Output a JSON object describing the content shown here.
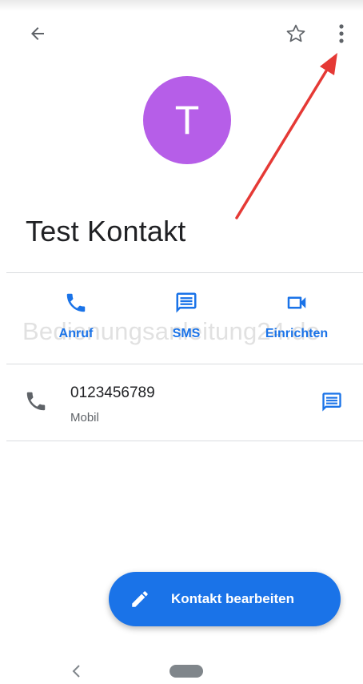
{
  "toolbar": {
    "back_icon": "arrow-back-icon",
    "favorite_icon": "star-outline-icon",
    "more_icon": "more-vert-icon"
  },
  "contact": {
    "initial": "T",
    "avatar_color": "#b65ee8",
    "name": "Test Kontakt"
  },
  "actions": [
    {
      "label": "Anruf",
      "icon": "phone-icon"
    },
    {
      "label": "SMS",
      "icon": "message-icon"
    },
    {
      "label": "Einrichten",
      "icon": "videocam-icon"
    }
  ],
  "watermark": "Bedienungsanleitung24.de",
  "phone": {
    "number": "0123456789",
    "type": "Mobil",
    "icon": "phone-icon",
    "message_icon": "message-icon"
  },
  "fab": {
    "label": "Kontakt bearbeiten",
    "icon": "pencil-icon"
  },
  "nav": {
    "back_icon": "nav-back-chevron-icon",
    "home_icon": "home-pill-icon"
  },
  "colors": {
    "accent": "#1a73e8",
    "annotation_arrow": "#e53935"
  }
}
